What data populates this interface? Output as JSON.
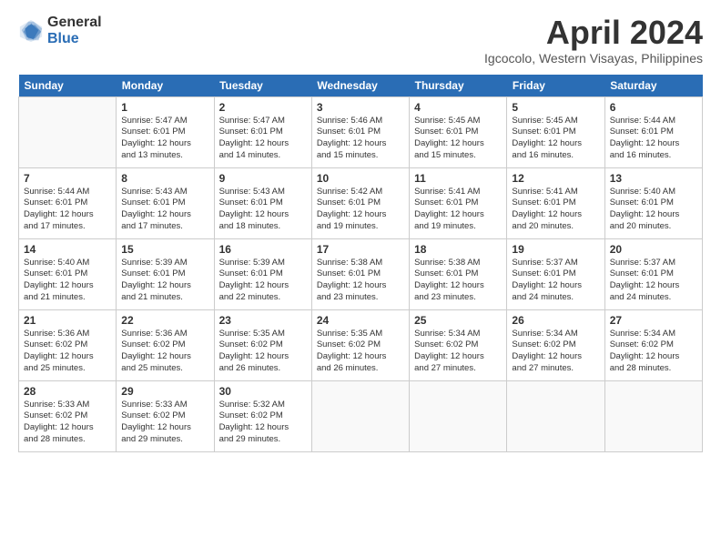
{
  "logo": {
    "general": "General",
    "blue": "Blue"
  },
  "header": {
    "title": "April 2024",
    "subtitle": "Igcocolo, Western Visayas, Philippines"
  },
  "weekdays": [
    "Sunday",
    "Monday",
    "Tuesday",
    "Wednesday",
    "Thursday",
    "Friday",
    "Saturday"
  ],
  "weeks": [
    [
      {
        "day": "",
        "info": ""
      },
      {
        "day": "1",
        "info": "Sunrise: 5:47 AM\nSunset: 6:01 PM\nDaylight: 12 hours\nand 13 minutes."
      },
      {
        "day": "2",
        "info": "Sunrise: 5:47 AM\nSunset: 6:01 PM\nDaylight: 12 hours\nand 14 minutes."
      },
      {
        "day": "3",
        "info": "Sunrise: 5:46 AM\nSunset: 6:01 PM\nDaylight: 12 hours\nand 15 minutes."
      },
      {
        "day": "4",
        "info": "Sunrise: 5:45 AM\nSunset: 6:01 PM\nDaylight: 12 hours\nand 15 minutes."
      },
      {
        "day": "5",
        "info": "Sunrise: 5:45 AM\nSunset: 6:01 PM\nDaylight: 12 hours\nand 16 minutes."
      },
      {
        "day": "6",
        "info": "Sunrise: 5:44 AM\nSunset: 6:01 PM\nDaylight: 12 hours\nand 16 minutes."
      }
    ],
    [
      {
        "day": "7",
        "info": "Sunrise: 5:44 AM\nSunset: 6:01 PM\nDaylight: 12 hours\nand 17 minutes."
      },
      {
        "day": "8",
        "info": "Sunrise: 5:43 AM\nSunset: 6:01 PM\nDaylight: 12 hours\nand 17 minutes."
      },
      {
        "day": "9",
        "info": "Sunrise: 5:43 AM\nSunset: 6:01 PM\nDaylight: 12 hours\nand 18 minutes."
      },
      {
        "day": "10",
        "info": "Sunrise: 5:42 AM\nSunset: 6:01 PM\nDaylight: 12 hours\nand 19 minutes."
      },
      {
        "day": "11",
        "info": "Sunrise: 5:41 AM\nSunset: 6:01 PM\nDaylight: 12 hours\nand 19 minutes."
      },
      {
        "day": "12",
        "info": "Sunrise: 5:41 AM\nSunset: 6:01 PM\nDaylight: 12 hours\nand 20 minutes."
      },
      {
        "day": "13",
        "info": "Sunrise: 5:40 AM\nSunset: 6:01 PM\nDaylight: 12 hours\nand 20 minutes."
      }
    ],
    [
      {
        "day": "14",
        "info": "Sunrise: 5:40 AM\nSunset: 6:01 PM\nDaylight: 12 hours\nand 21 minutes."
      },
      {
        "day": "15",
        "info": "Sunrise: 5:39 AM\nSunset: 6:01 PM\nDaylight: 12 hours\nand 21 minutes."
      },
      {
        "day": "16",
        "info": "Sunrise: 5:39 AM\nSunset: 6:01 PM\nDaylight: 12 hours\nand 22 minutes."
      },
      {
        "day": "17",
        "info": "Sunrise: 5:38 AM\nSunset: 6:01 PM\nDaylight: 12 hours\nand 23 minutes."
      },
      {
        "day": "18",
        "info": "Sunrise: 5:38 AM\nSunset: 6:01 PM\nDaylight: 12 hours\nand 23 minutes."
      },
      {
        "day": "19",
        "info": "Sunrise: 5:37 AM\nSunset: 6:01 PM\nDaylight: 12 hours\nand 24 minutes."
      },
      {
        "day": "20",
        "info": "Sunrise: 5:37 AM\nSunset: 6:01 PM\nDaylight: 12 hours\nand 24 minutes."
      }
    ],
    [
      {
        "day": "21",
        "info": "Sunrise: 5:36 AM\nSunset: 6:02 PM\nDaylight: 12 hours\nand 25 minutes."
      },
      {
        "day": "22",
        "info": "Sunrise: 5:36 AM\nSunset: 6:02 PM\nDaylight: 12 hours\nand 25 minutes."
      },
      {
        "day": "23",
        "info": "Sunrise: 5:35 AM\nSunset: 6:02 PM\nDaylight: 12 hours\nand 26 minutes."
      },
      {
        "day": "24",
        "info": "Sunrise: 5:35 AM\nSunset: 6:02 PM\nDaylight: 12 hours\nand 26 minutes."
      },
      {
        "day": "25",
        "info": "Sunrise: 5:34 AM\nSunset: 6:02 PM\nDaylight: 12 hours\nand 27 minutes."
      },
      {
        "day": "26",
        "info": "Sunrise: 5:34 AM\nSunset: 6:02 PM\nDaylight: 12 hours\nand 27 minutes."
      },
      {
        "day": "27",
        "info": "Sunrise: 5:34 AM\nSunset: 6:02 PM\nDaylight: 12 hours\nand 28 minutes."
      }
    ],
    [
      {
        "day": "28",
        "info": "Sunrise: 5:33 AM\nSunset: 6:02 PM\nDaylight: 12 hours\nand 28 minutes."
      },
      {
        "day": "29",
        "info": "Sunrise: 5:33 AM\nSunset: 6:02 PM\nDaylight: 12 hours\nand 29 minutes."
      },
      {
        "day": "30",
        "info": "Sunrise: 5:32 AM\nSunset: 6:02 PM\nDaylight: 12 hours\nand 29 minutes."
      },
      {
        "day": "",
        "info": ""
      },
      {
        "day": "",
        "info": ""
      },
      {
        "day": "",
        "info": ""
      },
      {
        "day": "",
        "info": ""
      }
    ]
  ]
}
